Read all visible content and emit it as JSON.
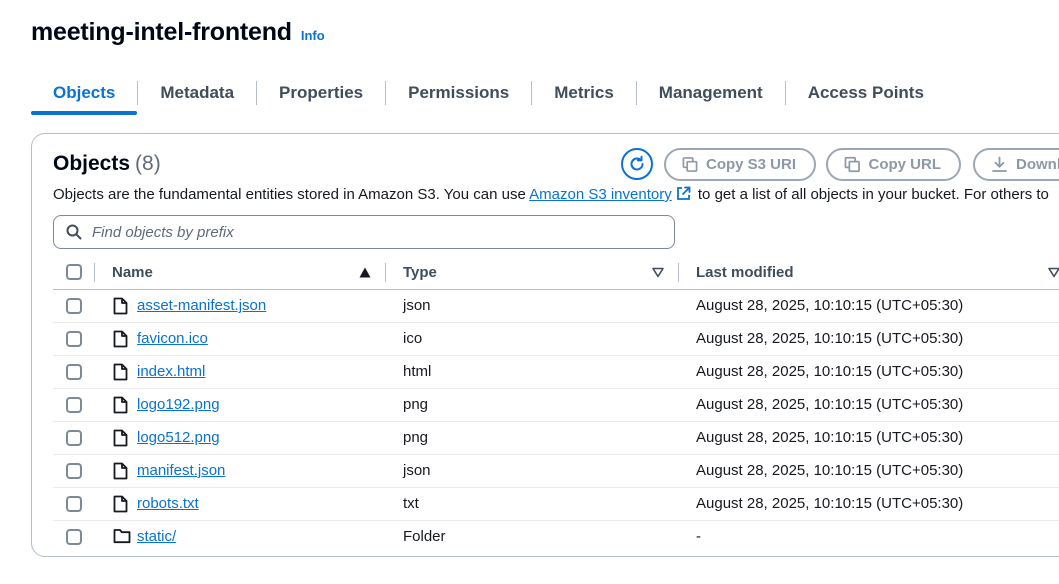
{
  "bucket": {
    "name": "meeting-intel-frontend",
    "info_label": "Info"
  },
  "tabs": [
    {
      "label": "Objects",
      "active": true
    },
    {
      "label": "Metadata"
    },
    {
      "label": "Properties"
    },
    {
      "label": "Permissions"
    },
    {
      "label": "Metrics"
    },
    {
      "label": "Management"
    },
    {
      "label": "Access Points"
    }
  ],
  "objects_panel": {
    "title": "Objects",
    "count": "(8)",
    "description_prefix": "Objects are the fundamental entities stored in Amazon S3. You can use ",
    "inventory_link": "Amazon S3 inventory",
    "description_suffix": " to get a list of all objects in your bucket. For others to",
    "buttons": {
      "copy_s3_uri": "Copy S3 URI",
      "copy_url": "Copy URL",
      "download": "Downl"
    },
    "search_placeholder": "Find objects by prefix"
  },
  "table": {
    "columns": {
      "name": "Name",
      "type": "Type",
      "last_modified": "Last modified"
    },
    "rows": [
      {
        "name": "asset-manifest.json",
        "type": "json",
        "last_modified": "August 28, 2025, 10:10:15 (UTC+05:30)",
        "icon": "file-icon"
      },
      {
        "name": "favicon.ico",
        "type": "ico",
        "last_modified": "August 28, 2025, 10:10:15 (UTC+05:30)",
        "icon": "file-icon"
      },
      {
        "name": "index.html",
        "type": "html",
        "last_modified": "August 28, 2025, 10:10:15 (UTC+05:30)",
        "icon": "file-icon"
      },
      {
        "name": "logo192.png",
        "type": "png",
        "last_modified": "August 28, 2025, 10:10:15 (UTC+05:30)",
        "icon": "file-icon"
      },
      {
        "name": "logo512.png",
        "type": "png",
        "last_modified": "August 28, 2025, 10:10:15 (UTC+05:30)",
        "icon": "file-icon"
      },
      {
        "name": "manifest.json",
        "type": "json",
        "last_modified": "August 28, 2025, 10:10:15 (UTC+05:30)",
        "icon": "file-icon"
      },
      {
        "name": "robots.txt",
        "type": "txt",
        "last_modified": "August 28, 2025, 10:10:15 (UTC+05:30)",
        "icon": "file-icon"
      },
      {
        "name": "static/",
        "type": "Folder",
        "last_modified": "-",
        "icon": "folder-icon"
      }
    ]
  },
  "colors": {
    "accent": "#0972d3",
    "text": "#16191f",
    "border": "#b6bec9",
    "disabled": "#8d99a8"
  }
}
